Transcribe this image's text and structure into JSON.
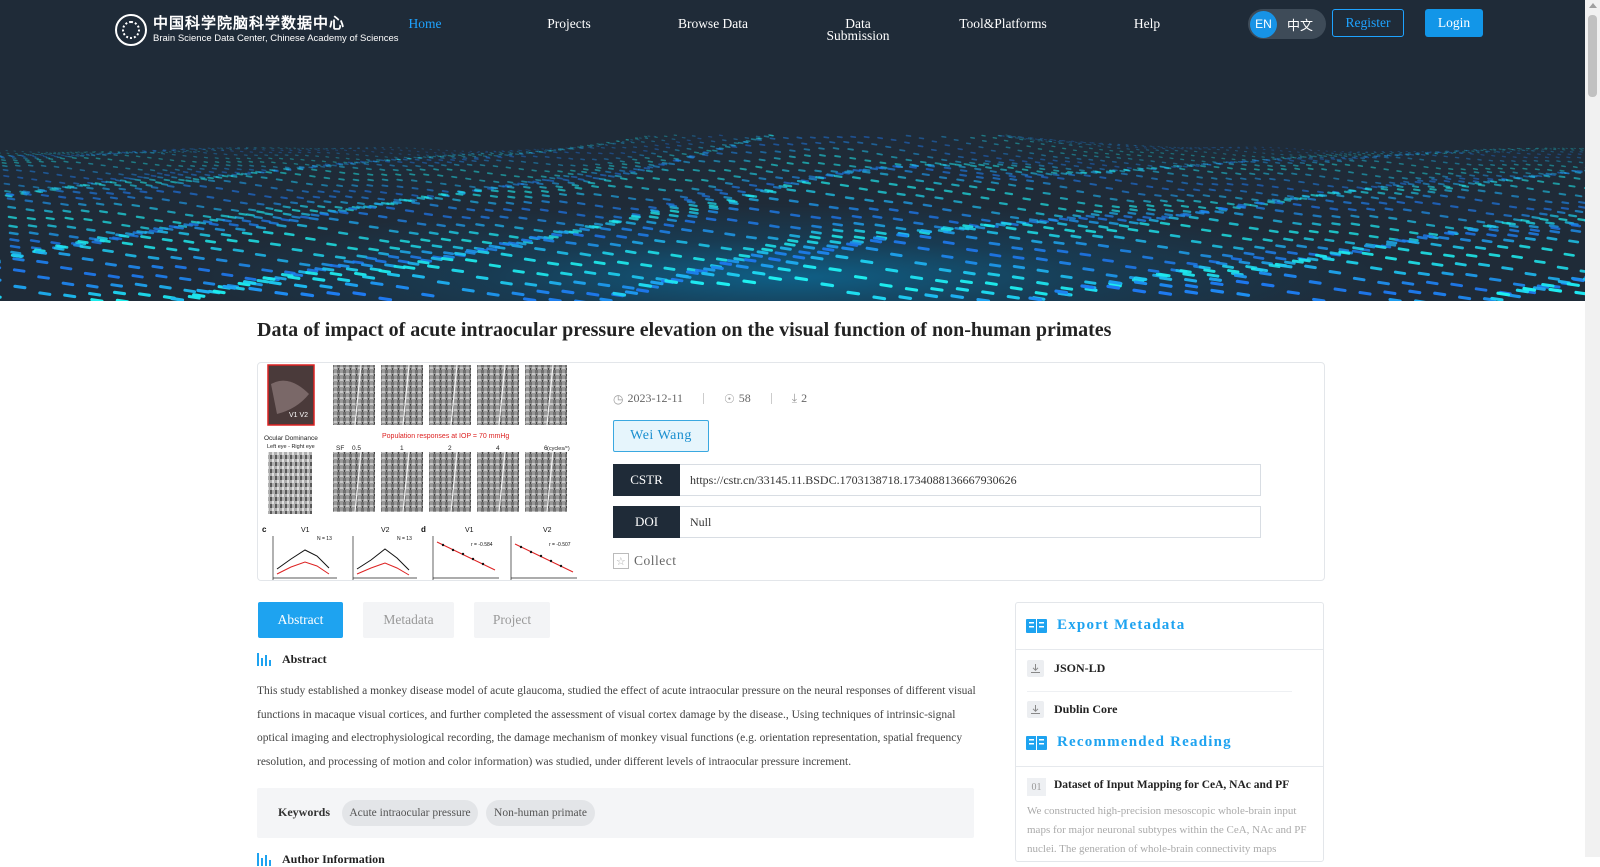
{
  "header": {
    "logo_cn": "中国科学院脑科学数据中心",
    "logo_en": "Brain Science Data Center, Chinese Academy of Sciences",
    "nav": [
      {
        "label": "Home",
        "active": true
      },
      {
        "label": "Projects"
      },
      {
        "label": "Browse Data"
      },
      {
        "label_line1": "Data",
        "label_line2": "Submission"
      },
      {
        "label": "Tool&Platforms"
      },
      {
        "label": "Help"
      }
    ],
    "lang_en": "EN",
    "lang_zh": "中文",
    "register": "Register",
    "login": "Login"
  },
  "dataset": {
    "title": "Data of impact of acute intraocular pressure elevation on the visual function of non-human primates",
    "date": "2023-12-11",
    "views": "58",
    "downloads": "2",
    "author": "Wei Wang",
    "cstr_label": "CSTR",
    "cstr_value": "https://cstr.cn/33145.11.BSDC.1703138718.1734088136667930626",
    "doi_label": "DOI",
    "doi_value": "Null",
    "collect": "Collect"
  },
  "figure": {
    "ocular_title": "Ocular Dominance",
    "ocular_sub": "Left eye - Right eye",
    "population_title": "Population responses at IOP = 70 mmHg",
    "sf_label": "SF",
    "sf_values": [
      "0.5",
      "1",
      "2",
      "4",
      "6"
    ],
    "sf_unit": "(cycles/°)",
    "panel_c": "c",
    "panel_d": "d",
    "v1": "V1",
    "v2": "V2",
    "v1v2": "V1 V2",
    "n13": "N = 13",
    "r1": "r = -0.584",
    "r2": "r = -0.507"
  },
  "tabs": [
    {
      "label": "Abstract",
      "active": true
    },
    {
      "label": "Metadata"
    },
    {
      "label": "Project"
    }
  ],
  "abstract": {
    "heading": "Abstract",
    "text": "This study established a monkey disease model of acute glaucoma, studied the effect of acute intraocular pressure on the neural responses of different visual functions in macaque visual cortices, and further completed the assessment of visual cortex damage by the disease., Using techniques of intrinsic-signal optical imaging and electrophysiological recording, the damage mechanism of monkey visual functions (e.g. orientation representation, spatial frequency resolution, and processing of motion and color information) was studied, under different levels of intraocular pressure increment."
  },
  "keywords": {
    "label": "Keywords",
    "items": [
      "Acute intraocular pressure",
      "Non-human primate"
    ]
  },
  "author_info_heading": "Author Information",
  "export": {
    "heading": "Export Metadata",
    "items": [
      "JSON-LD",
      "Dublin Core"
    ]
  },
  "recommended": {
    "heading": "Recommended Reading",
    "items": [
      {
        "num": "01",
        "title": "Dataset of Input Mapping for CeA, NAc and PF",
        "desc": "We constructed high-precision mesoscopic whole-brain input maps for major neuronal subtypes within the CeA, NAc and PF nuclei. The generation of whole-brain connectivity maps"
      }
    ]
  },
  "colors": {
    "accent": "#1ea3f0",
    "header_bg": "#1f2b38",
    "label_bg": "#1f2b38"
  }
}
